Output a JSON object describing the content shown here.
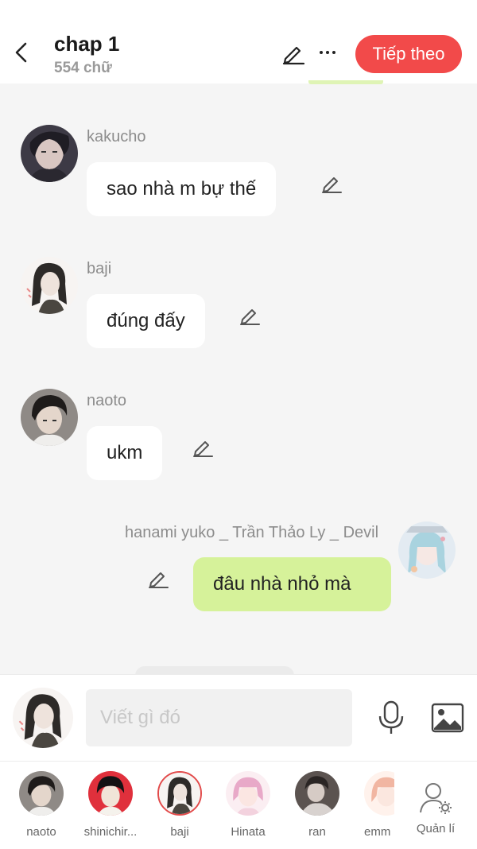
{
  "header": {
    "title": "chap 1",
    "word_count": "554 chữ",
    "next_label": "Tiếp theo"
  },
  "messages": [
    {
      "name": "kakucho",
      "text": "sao nhà m bự thế",
      "mine": false
    },
    {
      "name": "baji",
      "text": "đúng đấy",
      "mine": false
    },
    {
      "name": "naoto",
      "text": "ukm",
      "mine": false
    },
    {
      "name": "hanami yuko _ Trần Thảo Ly _ Devil",
      "text": "đâu nhà nhỏ mà",
      "mine": true
    }
  ],
  "composer": {
    "placeholder": "Viết gì đó"
  },
  "cast": [
    {
      "label": "naoto",
      "selected": false
    },
    {
      "label": "shinichir...",
      "selected": false
    },
    {
      "label": "baji",
      "selected": true
    },
    {
      "label": "Hinata",
      "selected": false
    },
    {
      "label": "ran",
      "selected": false
    },
    {
      "label": "emm",
      "selected": false
    }
  ],
  "manage_label": "Quản lí",
  "colors": {
    "accent": "#f24a4a",
    "my_bubble": "#d6f29a",
    "background": "#f5f5f5"
  },
  "icons": [
    "back-arrow-icon",
    "pencil-icon",
    "more-dots-icon",
    "microphone-icon",
    "image-icon",
    "user-settings-icon"
  ]
}
